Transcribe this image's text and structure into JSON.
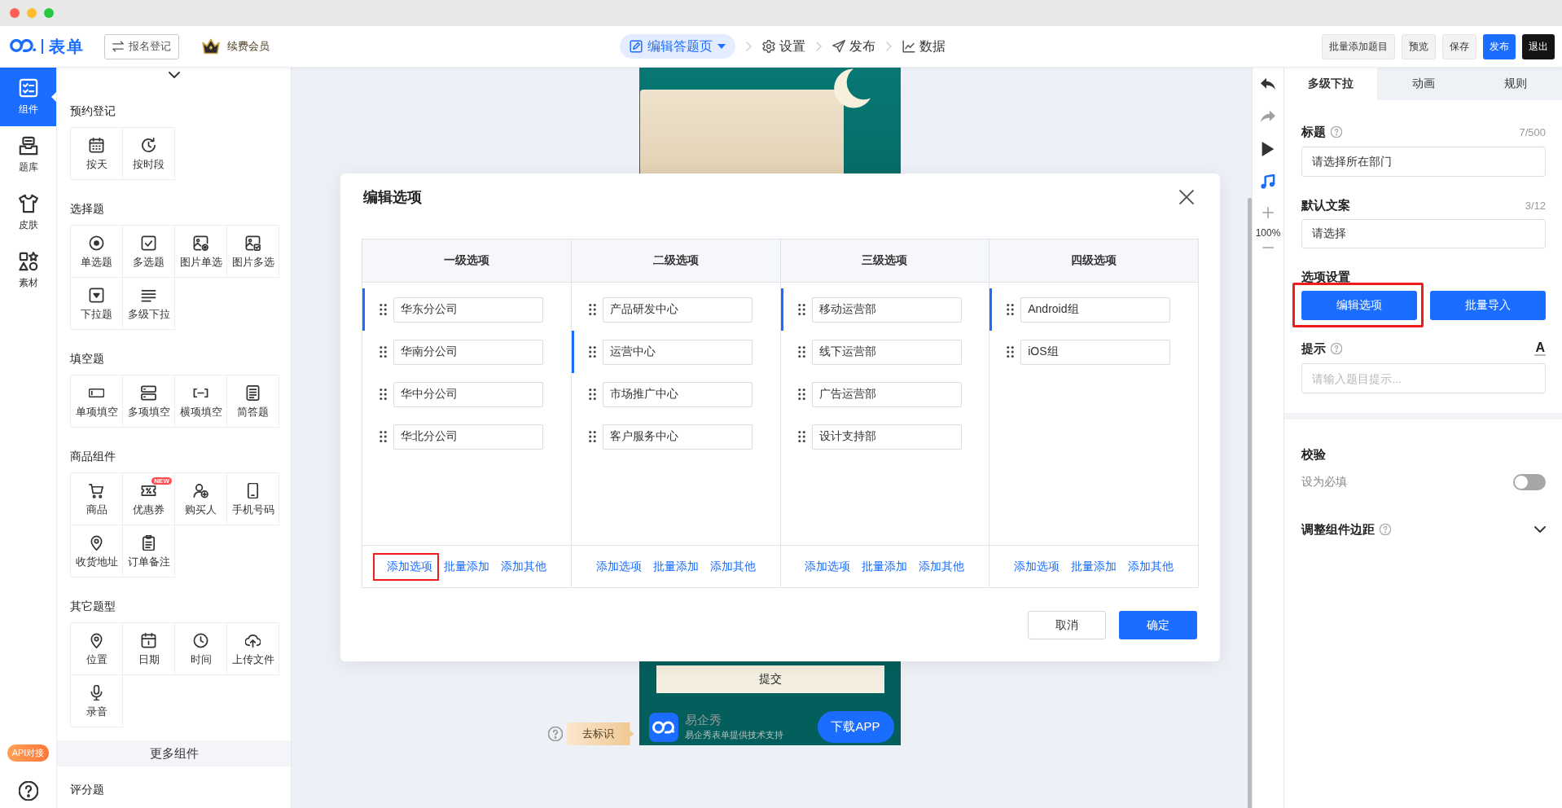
{
  "header": {
    "logo_text": "表单",
    "register_button": "报名登记",
    "member_link": "续费会员",
    "steps": [
      {
        "label": "编辑答题页",
        "selected": true
      },
      {
        "label": "设置",
        "selected": false
      },
      {
        "label": "发布",
        "selected": false
      },
      {
        "label": "数据",
        "selected": false
      }
    ],
    "actions": [
      {
        "label": "批量添加题目",
        "kind": "default"
      },
      {
        "label": "预览",
        "kind": "default"
      },
      {
        "label": "保存",
        "kind": "default"
      },
      {
        "label": "发布",
        "kind": "primary"
      },
      {
        "label": "退出",
        "kind": "dark"
      }
    ]
  },
  "nav_rail": {
    "items": [
      {
        "label": "组件",
        "selected": true
      },
      {
        "label": "题库",
        "selected": false
      },
      {
        "label": "皮肤",
        "selected": false
      },
      {
        "label": "素材",
        "selected": false
      }
    ],
    "api_badge": "API对接"
  },
  "component_panel": {
    "sections": [
      {
        "title": "预约登记",
        "items": [
          {
            "label": "按天"
          },
          {
            "label": "按时段"
          }
        ]
      },
      {
        "title": "选择题",
        "items": [
          {
            "label": "单选题"
          },
          {
            "label": "多选题"
          },
          {
            "label": "图片单选"
          },
          {
            "label": "图片多选"
          },
          {
            "label": "下拉题"
          },
          {
            "label": "多级下拉"
          }
        ]
      },
      {
        "title": "填空题",
        "items": [
          {
            "label": "单项填空"
          },
          {
            "label": "多项填空"
          },
          {
            "label": "横项填空"
          },
          {
            "label": "简答题"
          }
        ]
      },
      {
        "title": "商品组件",
        "items": [
          {
            "label": "商品"
          },
          {
            "label": "优惠券",
            "badge": "NEW"
          },
          {
            "label": "购买人"
          },
          {
            "label": "手机号码"
          },
          {
            "label": "收货地址"
          },
          {
            "label": "订单备注"
          }
        ]
      },
      {
        "title": "其它题型",
        "items": [
          {
            "label": "位置"
          },
          {
            "label": "日期"
          },
          {
            "label": "时间"
          },
          {
            "label": "上传文件"
          },
          {
            "label": "录音"
          }
        ]
      }
    ],
    "more_bar": "更多组件",
    "next_section_title": "评分题"
  },
  "canvas": {
    "remove_mark_tag": "去标识",
    "submit_button": "提交",
    "brand_name": "易企秀",
    "brand_tagline": "易企秀表单提供技术支持",
    "download_button": "下载APP"
  },
  "modal": {
    "title": "编辑选项",
    "columns": [
      {
        "header": "一级选项",
        "options": [
          {
            "text": "华东分公司",
            "selected": true
          },
          {
            "text": "华南分公司",
            "selected": false
          },
          {
            "text": "华中分公司",
            "selected": false
          },
          {
            "text": "华北分公司",
            "selected": false
          }
        ],
        "actions": [
          {
            "label": "添加选项",
            "highlighted": true
          },
          {
            "label": "批量添加",
            "highlighted": false
          },
          {
            "label": "添加其他",
            "highlighted": false
          }
        ]
      },
      {
        "header": "二级选项",
        "options": [
          {
            "text": "产品研发中心",
            "selected": false
          },
          {
            "text": "运营中心",
            "selected": true
          },
          {
            "text": "市场推广中心",
            "selected": false
          },
          {
            "text": "客户服务中心",
            "selected": false
          }
        ],
        "actions": [
          {
            "label": "添加选项",
            "highlighted": false
          },
          {
            "label": "批量添加",
            "highlighted": false
          },
          {
            "label": "添加其他",
            "highlighted": false
          }
        ]
      },
      {
        "header": "三级选项",
        "options": [
          {
            "text": "移动运营部",
            "selected": true
          },
          {
            "text": "线下运营部",
            "selected": false
          },
          {
            "text": "广告运营部",
            "selected": false
          },
          {
            "text": "设计支持部",
            "selected": false
          }
        ],
        "actions": [
          {
            "label": "添加选项",
            "highlighted": false
          },
          {
            "label": "批量添加",
            "highlighted": false
          },
          {
            "label": "添加其他",
            "highlighted": false
          }
        ]
      },
      {
        "header": "四级选项",
        "options": [
          {
            "text": "Android组",
            "selected": true
          },
          {
            "text": "iOS组",
            "selected": false
          }
        ],
        "actions": [
          {
            "label": "添加选项",
            "highlighted": false
          },
          {
            "label": "批量添加",
            "highlighted": false
          },
          {
            "label": "添加其他",
            "highlighted": false
          }
        ]
      }
    ],
    "buttons": [
      {
        "label": "取消",
        "kind": "default"
      },
      {
        "label": "确定",
        "kind": "primary"
      }
    ]
  },
  "tool_strip": {
    "zoom_level": "100%"
  },
  "properties_panel": {
    "tabs": [
      {
        "label": "多级下拉",
        "selected": true
      },
      {
        "label": "动画",
        "selected": false
      },
      {
        "label": "规则",
        "selected": false
      }
    ],
    "fields": [
      {
        "label": "标题",
        "help_icon": true,
        "counter": "7/500",
        "value": "请选择所在部门"
      },
      {
        "label": "默认文案",
        "help_icon": false,
        "counter": "3/12",
        "value": "请选择"
      }
    ],
    "option_settings": {
      "title": "选项设置",
      "buttons": [
        {
          "label": "编辑选项",
          "highlighted": true
        },
        {
          "label": "批量导入",
          "highlighted": false
        }
      ]
    },
    "hint": {
      "label": "提示",
      "help_icon": true,
      "text_style_button": "A",
      "placeholder": "请输入题目提示..."
    },
    "validation": {
      "title": "校验",
      "required_label": "设为必填",
      "required_on": false
    },
    "margin_section": {
      "title": "调整组件边距",
      "help_icon": true,
      "expanded": false
    }
  }
}
